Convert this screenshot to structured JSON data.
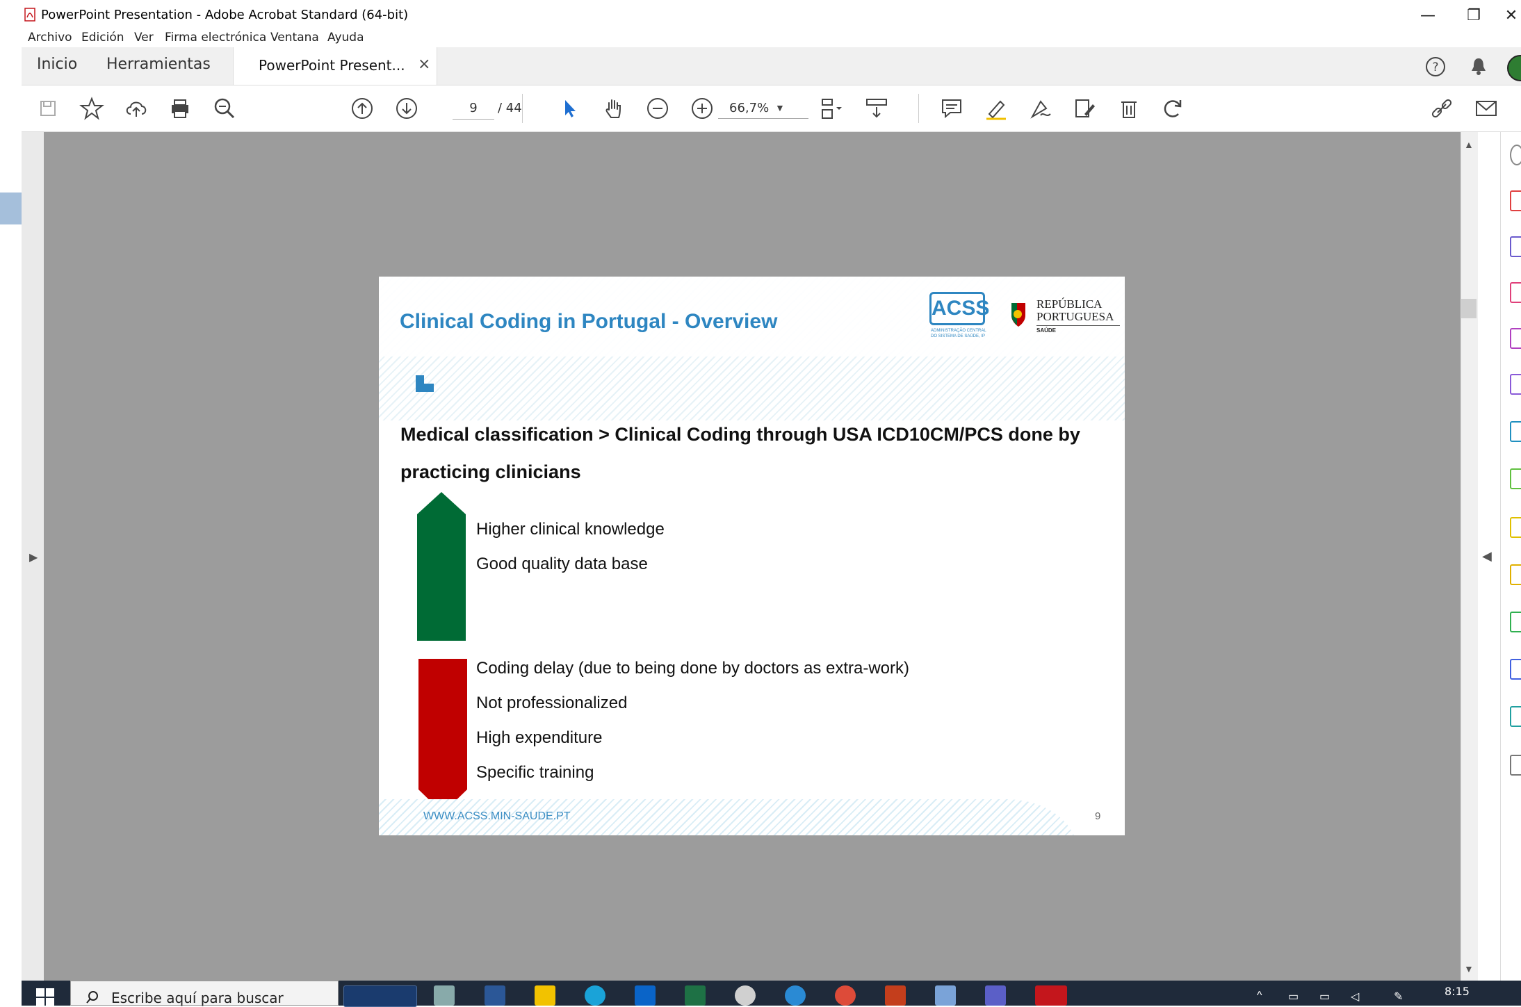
{
  "window": {
    "title": "PowerPoint Presentation - Adobe Acrobat Standard (64-bit)",
    "controls": {
      "minimize": "—",
      "restore": "❐",
      "close": "✕"
    }
  },
  "menu": [
    "Archivo",
    "Edición",
    "Ver",
    "Firma electrónica",
    "Ventana",
    "Ayuda"
  ],
  "tabs": {
    "home": "Inicio",
    "tools": "Herramientas",
    "document": "PowerPoint Present...",
    "close_glyph": "×"
  },
  "toolbar": {
    "page_current": "9",
    "page_total": "/ 44",
    "zoom": "66,7%",
    "icons": [
      "save-icon",
      "star-icon",
      "upload-icon",
      "print-icon",
      "search-zoom-icon",
      "page-up-icon",
      "page-down-icon",
      "select-pointer-icon",
      "hand-icon",
      "zoom-out-icon",
      "zoom-in-icon",
      "page-layout-icon",
      "scroll-mode-icon",
      "comment-icon",
      "highlight-icon",
      "sign-icon",
      "edit-pdf-icon",
      "delete-icon",
      "rotate-icon",
      "share-link-icon",
      "email-icon"
    ]
  },
  "header_right_icons": [
    "help-icon",
    "bell-icon",
    "avatar"
  ],
  "slide": {
    "title": "Clinical Coding in Portugal - Overview",
    "acss_logo": "ACSS",
    "acss_sub": "ADMINISTRAÇÃO CENTRAL DO SISTEMA DE SAÚDE, IP",
    "republic_line1": "REPÚBLICA",
    "republic_line2": "PORTUGUESA",
    "republic_sub": "SAÚDE",
    "heading_line1": "Medical classification > Clinical Coding through USA ICD10CM/PCS done by",
    "heading_line2": "practicing clinicians",
    "pros": [
      "Higher clinical knowledge",
      "Good quality data base"
    ],
    "cons": [
      "Coding delay (due to being done by doctors as extra-work)",
      "Not professionalized",
      "High expenditure",
      "Specific training"
    ],
    "footer_url": "WWW.ACSS.MIN-SAUDE.PT",
    "page_number": "9",
    "colors": {
      "title": "#2e86c1",
      "pros_arrow": "#006b35",
      "cons_arrow": "#c00000"
    }
  },
  "taskbar": {
    "search_placeholder": "Escribe aquí para buscar",
    "clock": "8:15"
  }
}
